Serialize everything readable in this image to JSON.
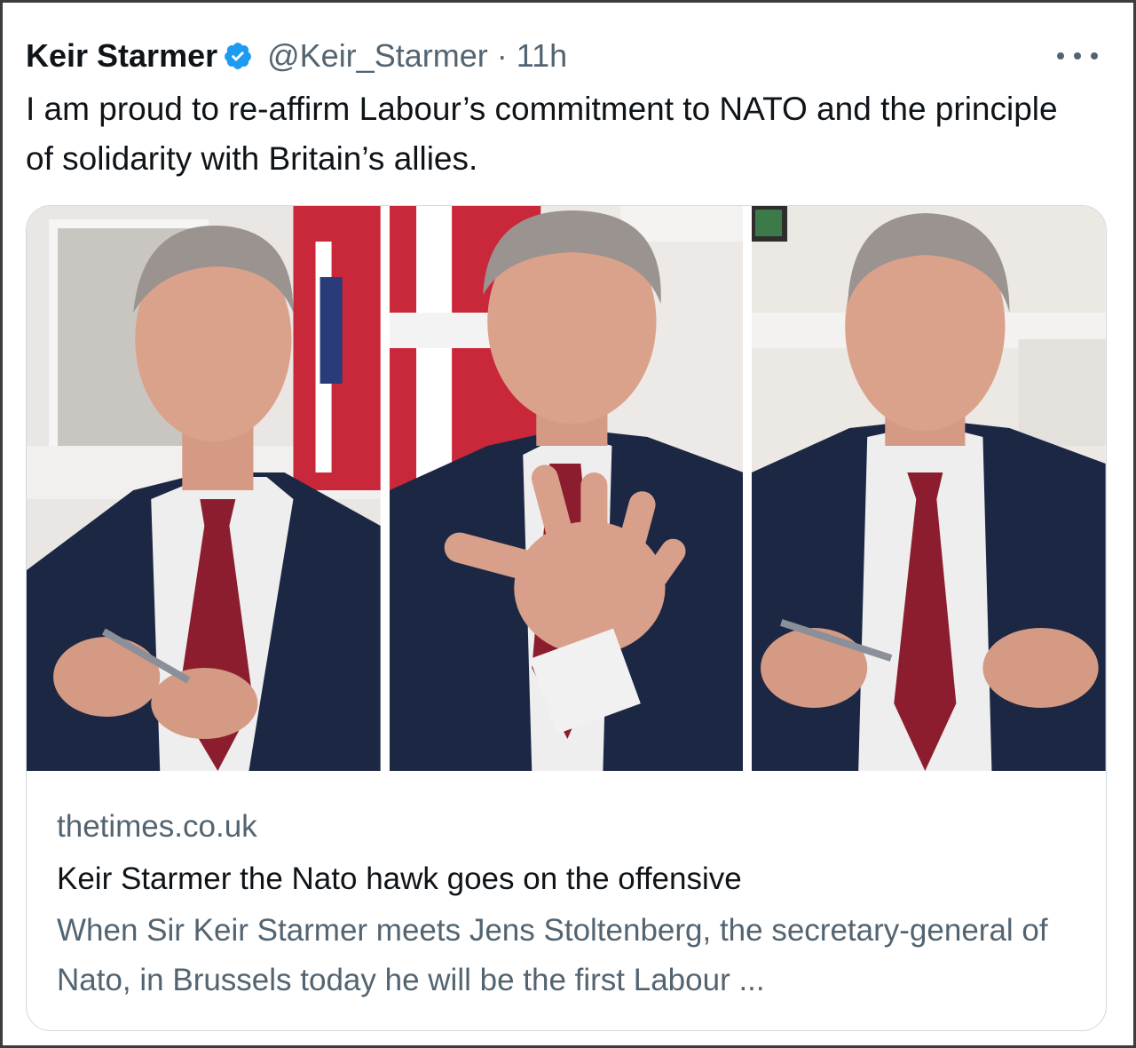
{
  "tweet": {
    "author_name": "Keir Starmer",
    "handle": "@Keir_Starmer",
    "separator": "·",
    "time": "11h",
    "verified_icon": "verified-badge-icon",
    "more_icon": "more-options-icon",
    "text": "I am proud to re-affirm Labour’s commitment to NATO and the principle of solidarity with Britain’s allies."
  },
  "card": {
    "domain": "thetimes.co.uk",
    "title": "Keir Starmer the Nato hawk goes on the offensive",
    "description": "When Sir Keir Starmer meets Jens Stoltenberg, the secretary-general of Nato, in Brussels today he will be the first Labour ..."
  },
  "colors": {
    "text_primary": "#0f1419",
    "text_secondary": "#536471",
    "verified_blue": "#1d9bf0",
    "border": "#cfd9de"
  }
}
